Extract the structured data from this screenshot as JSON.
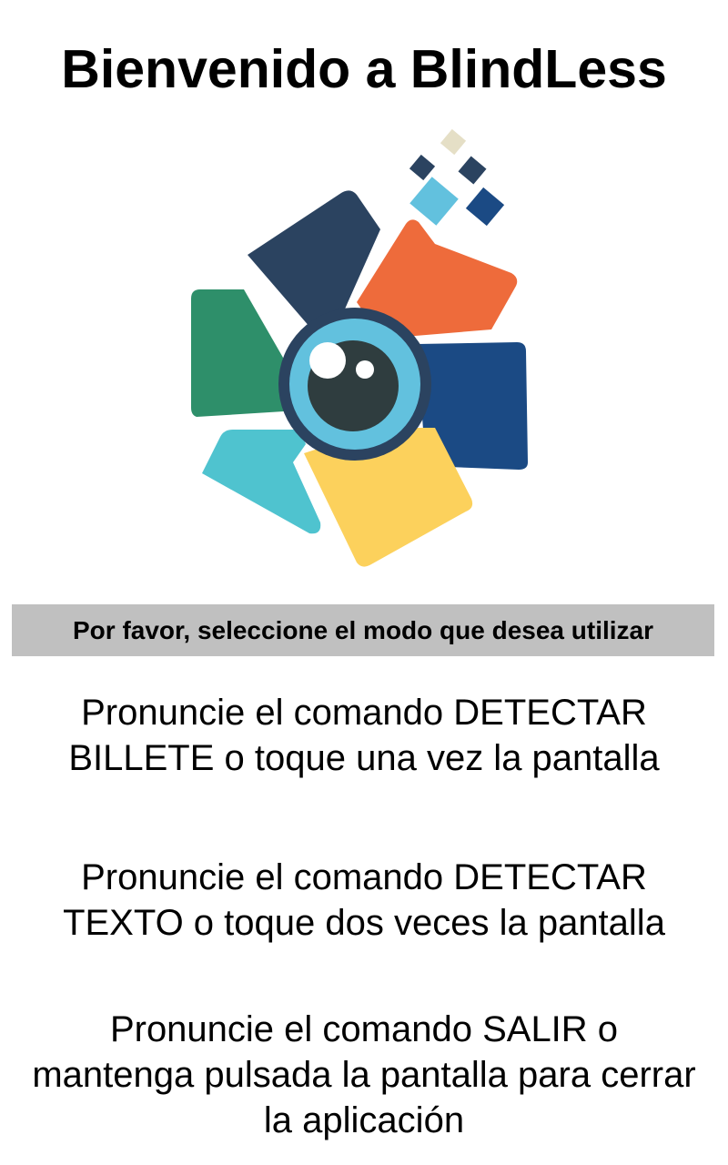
{
  "app": {
    "welcome_title": "Bienvenido a BlindLess"
  },
  "logo": {
    "icon": "camera-aperture-logo",
    "colors": {
      "navy": "#2b4360",
      "orange": "#ee6b3b",
      "green": "#2e8f6a",
      "blue": "#1b4a84",
      "cyan": "#4fc3cf",
      "yellow": "#fcd15c",
      "lens_ring": "#2b4360",
      "lens_iris": "#62c1de",
      "lens_pupil": "#2f3d3f",
      "pixel_light": "#e5dfc6",
      "pixel_sky": "#62c1de"
    }
  },
  "banner": {
    "text": "Por favor, seleccione el modo que desea utilizar",
    "background": "#c0c0c0"
  },
  "instructions": [
    {
      "text": "Pronuncie el comando DETECTAR BILLETE o toque una vez la pantalla"
    },
    {
      "text": "Pronuncie el comando DETECTAR TEXTO o toque dos veces la pantalla"
    },
    {
      "text": "Pronuncie el comando SALIR o mantenga pulsada la pantalla para cerrar la aplicación"
    }
  ]
}
